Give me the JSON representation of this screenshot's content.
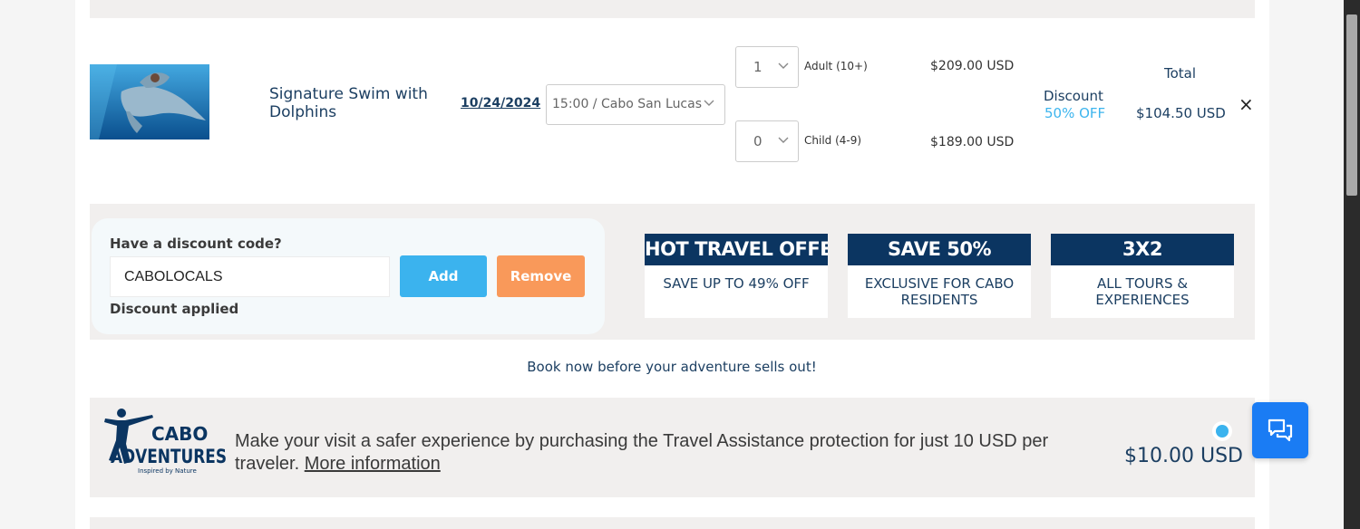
{
  "cart_item": {
    "image_icon": "dolphin-photo",
    "name": "Signature Swim with Dolphins",
    "date": "10/24/2024",
    "time_select": "15:00 / Cabo San Lucas",
    "adult": {
      "qty": "1",
      "label": "Adult (10+)",
      "price": "$209.00 USD"
    },
    "child": {
      "qty": "0",
      "label": "Child (4-9)",
      "price": "$189.00 USD"
    },
    "discount_title": "Discount",
    "discount_value": "50% OFF",
    "total_title": "Total",
    "total_value": "$104.50 USD",
    "remove_icon": "×"
  },
  "discount_code": {
    "label": "Have a discount code?",
    "value": "CABOLOCALS",
    "add_label": "Add",
    "remove_label": "Remove",
    "status": "Discount applied"
  },
  "offers": [
    {
      "title": "HOT TRAVEL OFFER",
      "body": "SAVE UP TO 49% OFF"
    },
    {
      "title": "SAVE 50%",
      "body": "EXCLUSIVE FOR CABO RESIDENTS"
    },
    {
      "title": "3X2",
      "body": "ALL TOURS & EXPERIENCES"
    }
  ],
  "urgency_text": "Book now before your adventure sells out!",
  "insurance": {
    "logo_text": [
      "CABO",
      "ADVENTURES",
      "Inspired by Nature"
    ],
    "text": "Make your visit a safer experience by purchasing the Travel Assistance protection for just 10 USD per traveler.",
    "link": "More information",
    "price": "$10.00 USD",
    "selected": true
  },
  "chat_icon": "chat-icon",
  "colors": {
    "navy": "#0b3561",
    "text_blue": "#1c3f62",
    "accent_blue": "#3bb3ee",
    "accent_orange": "#f9995a",
    "chat_blue": "#1a7cf4"
  }
}
